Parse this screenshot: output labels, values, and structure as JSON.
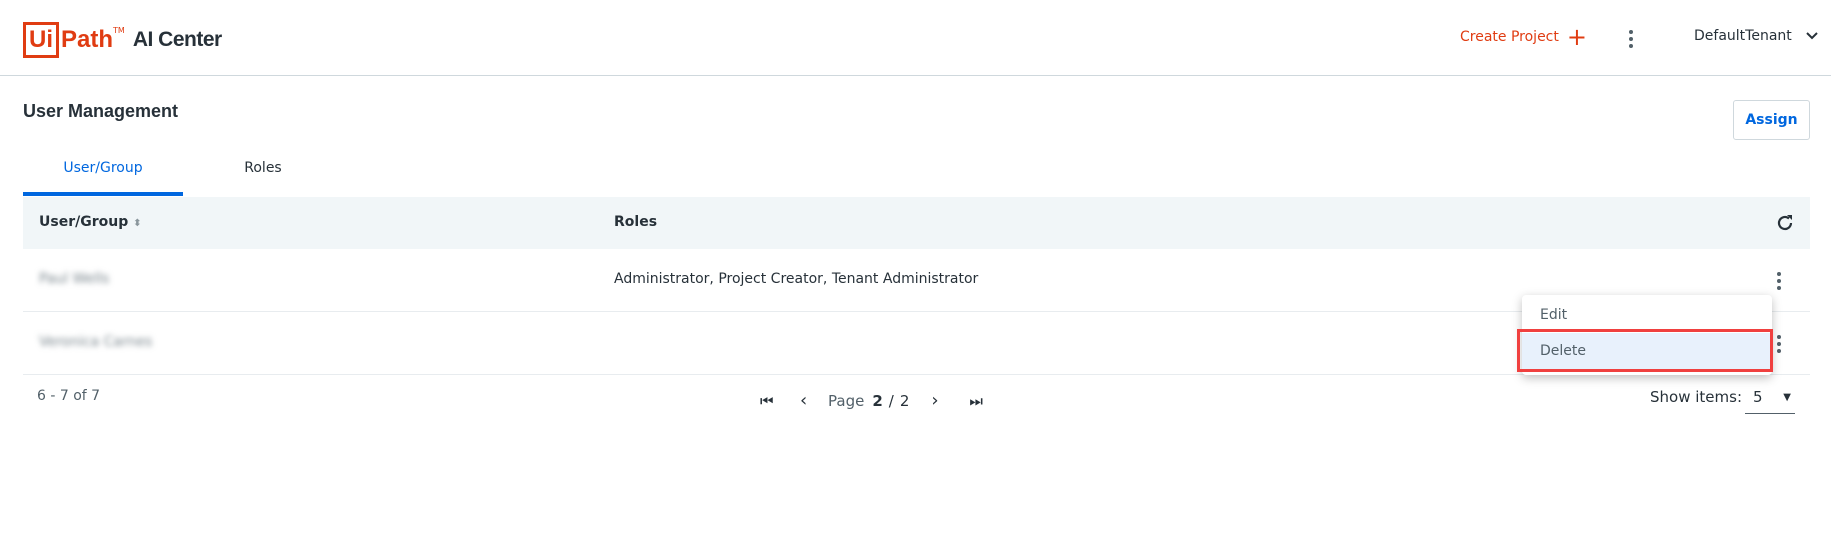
{
  "header": {
    "logo_ui": "Ui",
    "logo_path": "Path",
    "logo_tm": "TM",
    "product": "AI Center",
    "create_project": "Create Project",
    "tenant": "DefaultTenant"
  },
  "page": {
    "title": "User Management",
    "assign": "Assign"
  },
  "tabs": [
    {
      "label": "User/Group",
      "active": true
    },
    {
      "label": "Roles",
      "active": false
    }
  ],
  "table": {
    "columns": [
      "User/Group",
      "Roles"
    ],
    "rows": [
      {
        "user": "Paul Wells",
        "roles": "Administrator, Project Creator, Tenant Administrator"
      },
      {
        "user": "Veronica Carnes",
        "roles": ""
      }
    ]
  },
  "context_menu": {
    "items": [
      "Edit",
      "Delete"
    ],
    "highlighted": "Delete"
  },
  "pagination": {
    "range": "6 - 7 of 7",
    "page_label": "Page",
    "current": "2",
    "separator": "/",
    "total": "2",
    "show_items_label": "Show items:",
    "page_size": "5"
  },
  "colors": {
    "brand": "#e03c12",
    "accent": "#0067df",
    "highlight_border": "#f0403f"
  }
}
